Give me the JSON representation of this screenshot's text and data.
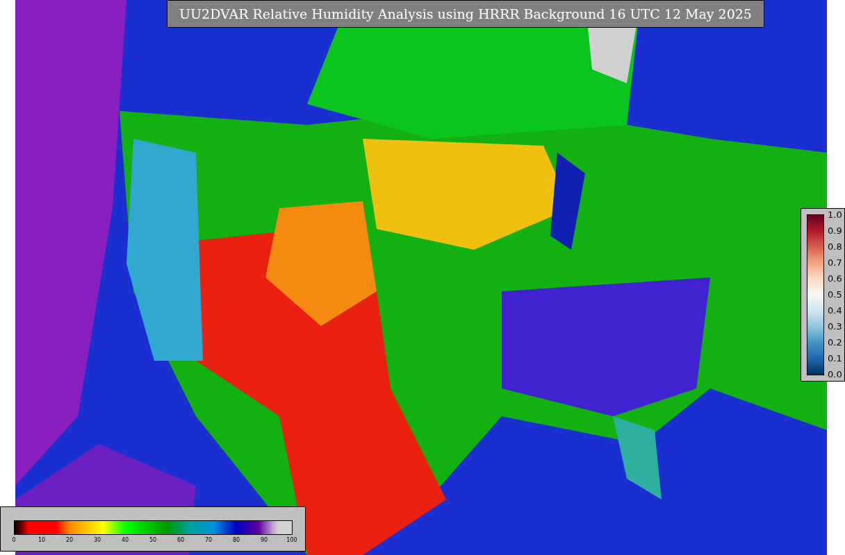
{
  "title": "UU2DVAR Relative Humidity Analysis using HRRR Background 16 UTC 12 May 2025",
  "observation_colorbar": {
    "ticks": [
      "1.0",
      "0.9",
      "0.8",
      "0.7",
      "0.6",
      "0.5",
      "0.4",
      "0.3",
      "0.2",
      "0.1",
      "0.0"
    ]
  },
  "analysis_colorbar": {
    "ticks": [
      "0",
      "10",
      "20",
      "30",
      "40",
      "50",
      "60",
      "70",
      "80",
      "90",
      "100"
    ]
  }
}
